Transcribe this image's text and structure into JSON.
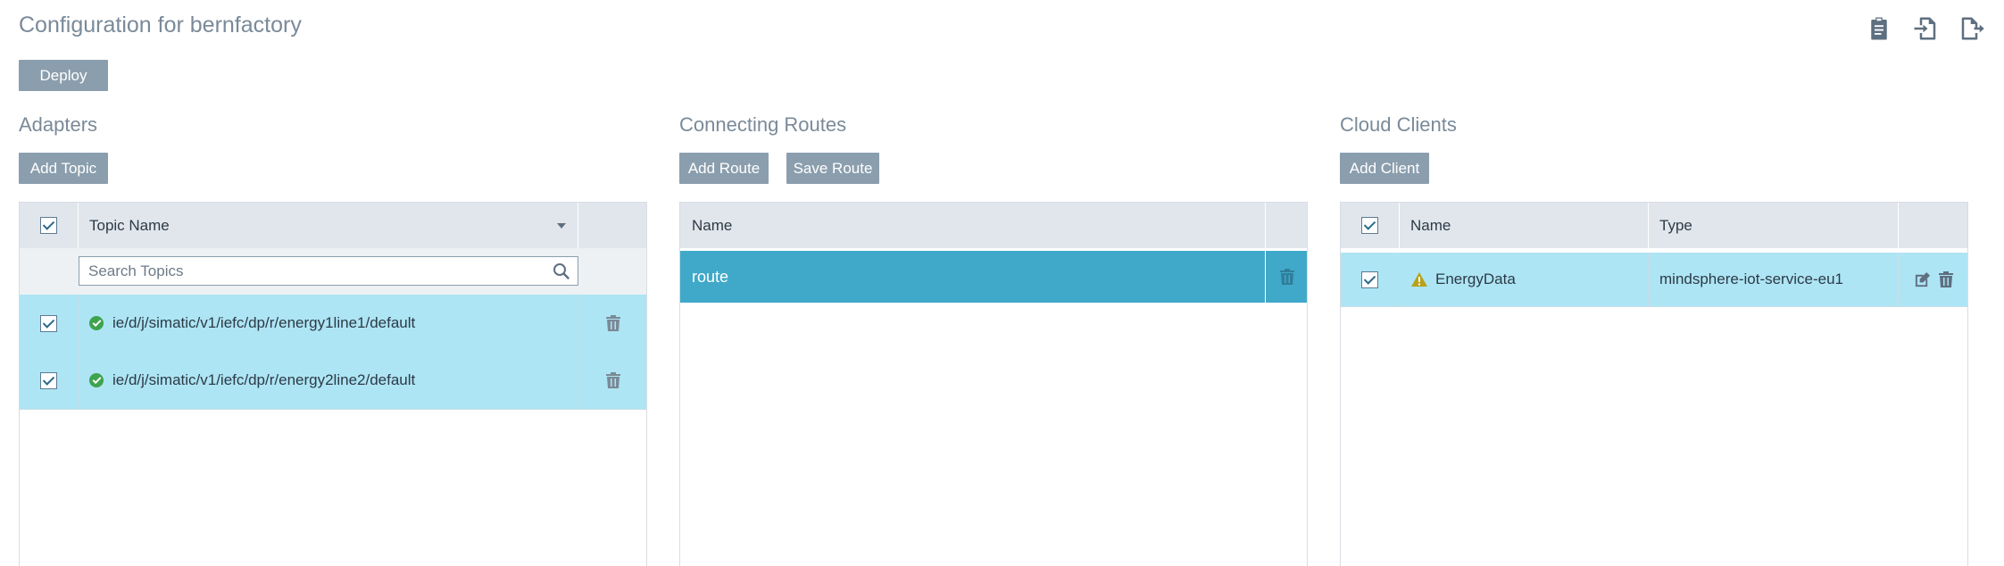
{
  "page": {
    "title": "Configuration for bernfactory"
  },
  "toolbar": {
    "deploy_label": "Deploy",
    "icons": [
      "clipboard-icon",
      "file-import-icon",
      "file-export-icon"
    ]
  },
  "adapters": {
    "title": "Adapters",
    "add_label": "Add Topic",
    "columns": {
      "topic_name": "Topic Name"
    },
    "search_placeholder": "Search Topics",
    "rows": [
      {
        "topic": "ie/d/j/simatic/v1/iefc/dp/r/energy1line1/default",
        "checked": true,
        "status": "ok"
      },
      {
        "topic": "ie/d/j/simatic/v1/iefc/dp/r/energy2line2/default",
        "checked": true,
        "status": "ok"
      }
    ]
  },
  "routes": {
    "title": "Connecting Routes",
    "add_label": "Add Route",
    "save_label": "Save Route",
    "columns": {
      "name": "Name"
    },
    "rows": [
      {
        "name": "route",
        "selected": true
      }
    ]
  },
  "clients": {
    "title": "Cloud Clients",
    "add_label": "Add Client",
    "columns": {
      "name": "Name",
      "type": "Type"
    },
    "rows": [
      {
        "name": "EnergyData",
        "type": "mindsphere-iot-service-eu1",
        "checked": true,
        "status": "warning"
      }
    ]
  },
  "colors": {
    "button": "#8b9eae",
    "header_bg": "#e1e6ec",
    "row_bg": "#ade5f4",
    "row_selected_bg": "#40a8c9",
    "ok": "#3fa34d",
    "warning": "#b8a21a"
  }
}
